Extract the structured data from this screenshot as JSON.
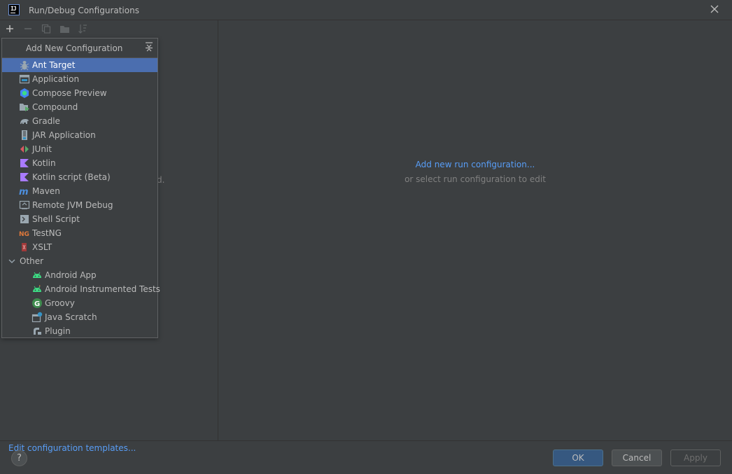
{
  "window": {
    "title": "Run/Debug Configurations"
  },
  "app_icon_text": "IJ",
  "toolbar": {
    "icons": [
      "plus-icon",
      "minus-icon",
      "copy-icon",
      "folder-icon",
      "sort-icon"
    ]
  },
  "left_pane": {
    "ghost_text": "d.",
    "edit_templates_link": "Edit configuration templates..."
  },
  "popup": {
    "title": "Add New Configuration",
    "items": [
      {
        "label": "Ant Target",
        "icon": "ant-icon",
        "selected": true
      },
      {
        "label": "Application",
        "icon": "application-icon"
      },
      {
        "label": "Compose Preview",
        "icon": "compose-icon"
      },
      {
        "label": "Compound",
        "icon": "compound-icon"
      },
      {
        "label": "Gradle",
        "icon": "gradle-icon"
      },
      {
        "label": "JAR Application",
        "icon": "jar-icon"
      },
      {
        "label": "JUnit",
        "icon": "junit-icon"
      },
      {
        "label": "Kotlin",
        "icon": "kotlin-icon"
      },
      {
        "label": "Kotlin script (Beta)",
        "icon": "kotlin-script-icon"
      },
      {
        "label": "Maven",
        "icon": "maven-icon"
      },
      {
        "label": "Remote JVM Debug",
        "icon": "remote-debug-icon"
      },
      {
        "label": "Shell Script",
        "icon": "shell-script-icon"
      },
      {
        "label": "TestNG",
        "icon": "testng-icon"
      },
      {
        "label": "XSLT",
        "icon": "xslt-icon"
      }
    ],
    "other_group": {
      "label": "Other",
      "items": [
        {
          "label": "Android App",
          "icon": "android-icon"
        },
        {
          "label": "Android Instrumented Tests",
          "icon": "android-test-icon"
        },
        {
          "label": "Groovy",
          "icon": "groovy-icon"
        },
        {
          "label": "Java Scratch",
          "icon": "java-scratch-icon"
        },
        {
          "label": "Plugin",
          "icon": "plugin-icon"
        }
      ]
    }
  },
  "right_pane": {
    "add_link": "Add new run configuration...",
    "hint": "or select run configuration to edit"
  },
  "footer": {
    "help_label": "?",
    "ok_label": "OK",
    "cancel_label": "Cancel",
    "apply_label": "Apply"
  },
  "colors": {
    "background": "#3c3f41",
    "selection": "#4b6eaf",
    "link": "#589df6",
    "ok_button": "#365880"
  }
}
